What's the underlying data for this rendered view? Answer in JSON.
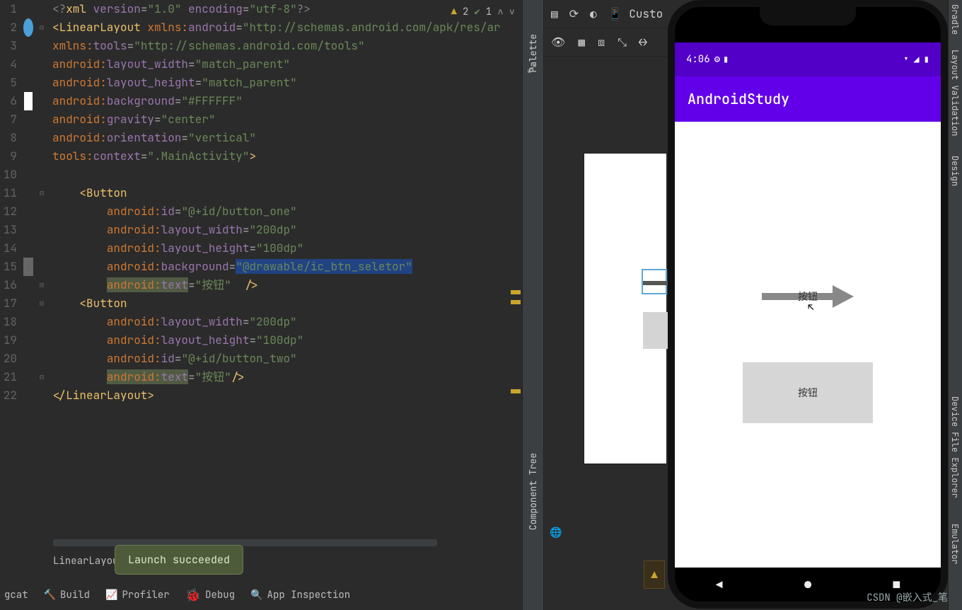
{
  "editor": {
    "corner": {
      "warn_count": "2",
      "pass_count": "1"
    },
    "tab": "LinearLayou",
    "toast": "Launch succeeded",
    "scrollbar_hint": "",
    "lines": [
      {
        "n": 1,
        "html": "<span class='c'>&lt;?</span><span class='t'>xml</span> <span class='pn'>version</span>=<span class='s'>\"1.0\"</span> <span class='pn'>encoding</span>=<span class='s'>\"utf-8\"</span><span class='c'>?&gt;</span>"
      },
      {
        "n": 2,
        "icon": "circle",
        "fold": "⊟",
        "html": "<span class='t'>&lt;LinearLayout</span> <span class='p'>xmlns:</span><span class='pn'>android</span>=<span class='s'>\"http://schemas.android.com/apk/res/ar</span>"
      },
      {
        "n": 3,
        "html": "<span class='p'>xmlns:</span><span class='pn'>tools</span>=<span class='s'>\"http://schemas.android.com/tools\"</span>"
      },
      {
        "n": 4,
        "html": "<span class='p'>android:</span><span class='pn'>layout_width</span>=<span class='s'>\"match_parent\"</span>"
      },
      {
        "n": 5,
        "html": "<span class='p'>android:</span><span class='pn'>layout_height</span>=<span class='s'>\"match_parent\"</span>"
      },
      {
        "n": 6,
        "icon": "color",
        "html": "<span class='p'>android:</span><span class='pn'>background</span>=<span class='s'>\"#FFFFFF\"</span>"
      },
      {
        "n": 7,
        "html": "<span class='p'>android:</span><span class='pn'>gravity</span>=<span class='s'>\"center\"</span>"
      },
      {
        "n": 8,
        "html": "<span class='p'>android:</span><span class='pn'>orientation</span>=<span class='s'>\"vertical\"</span>"
      },
      {
        "n": 9,
        "html": "<span class='p'>tools:</span><span class='pn'>context</span>=<span class='s'>\".MainActivity\"</span><span class='t'>&gt;</span>"
      },
      {
        "n": 10,
        "html": ""
      },
      {
        "n": 11,
        "fold": "⊟",
        "html": "    <span class='t'>&lt;Button</span>"
      },
      {
        "n": 12,
        "html": "        <span class='p'>android:</span><span class='pn'>id</span>=<span class='s'>\"@+id/button_one\"</span>"
      },
      {
        "n": 13,
        "html": "        <span class='p'>android:</span><span class='pn'>layout_width</span>=<span class='s'>\"200dp\"</span>"
      },
      {
        "n": 14,
        "html": "        <span class='p'>android:</span><span class='pn'>layout_height</span>=<span class='s'>\"100dp\"</span>"
      },
      {
        "n": 15,
        "icon": "img",
        "html": "        <span class='p'>android:</span><span class='pn'>background</span>=<span class='pic hl s'>\"@drawable/ic_btn_seletor\"</span>"
      },
      {
        "n": 16,
        "fold": "⊟",
        "html": "        <span class='hl'><span class='p'>android:</span><span class='pn'>text</span></span>=<span class='s'>\"按钮\"</span>  <span class='t'>/&gt;</span>"
      },
      {
        "n": 17,
        "fold": "⊟",
        "html": "    <span class='t'>&lt;Button</span>"
      },
      {
        "n": 18,
        "html": "        <span class='p'>android:</span><span class='pn'>layout_width</span>=<span class='s'>\"200dp\"</span>"
      },
      {
        "n": 19,
        "html": "        <span class='p'>android:</span><span class='pn'>layout_height</span>=<span class='s'>\"100dp\"</span>"
      },
      {
        "n": 20,
        "html": "        <span class='p'>android:</span><span class='pn'>id</span>=<span class='s'>\"@+id/button_two\"</span>"
      },
      {
        "n": 21,
        "fold": "⊟",
        "html": "        <span class='hl'><span class='p'>android:</span><span class='pn'>text</span></span>=<span class='s'>\"按钮\"</span><span class='t'>/&gt;</span>"
      },
      {
        "n": 22,
        "html": "<span class='t'>&lt;/LinearLayout&gt;</span>"
      }
    ]
  },
  "bottom_tools": {
    "logcat": "gcat",
    "build": "Build",
    "profiler": "Profiler",
    "debug": "Debug",
    "app_inspection": "App Inspection"
  },
  "palette": {
    "label": "Palette",
    "tree_label": "Component Tree"
  },
  "designer": {
    "custom": "Custo",
    "icons": [
      "layers",
      "rotate",
      "dark",
      "phone"
    ]
  },
  "emulator": {
    "time": "4:06",
    "app_title": "AndroidStudy",
    "btn1_text": "按钮",
    "btn2_text": "按钮",
    "nav": [
      "◀",
      "●",
      "■"
    ]
  },
  "right_panels": [
    "Gradle",
    "Layout Validation",
    "Design",
    "Device File Explorer",
    "Emulator"
  ],
  "watermark": "CSDN @嵌入式_笔记"
}
